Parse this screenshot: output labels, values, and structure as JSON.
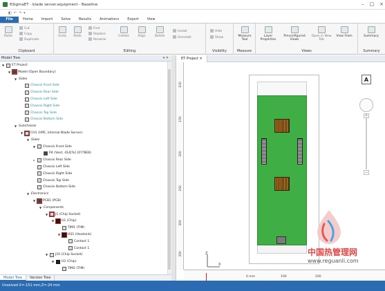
{
  "window": {
    "title": "6SigmaET - blade server.equipment - Baseline",
    "controls": [
      "–",
      "□",
      "×"
    ]
  },
  "quick_access": [
    "◧",
    "↶",
    "↷",
    "▾"
  ],
  "menu": [
    "File",
    "Home",
    "Import",
    "Solve",
    "Results",
    "Animations",
    "Export",
    "View"
  ],
  "ribbon": {
    "clipboard": {
      "label": "Clipboard",
      "paste": "Paste",
      "cut": "Cut",
      "copy": "Copy",
      "duplicate": "Duplicate"
    },
    "editing": {
      "label": "Editing",
      "undo": "Undo",
      "redo": "Redo",
      "find": "Find",
      "replace": "Replace",
      "rename": "Rename",
      "collate": "Collate",
      "align": "Align",
      "delete": "Delete",
      "install": "Install",
      "uninstall": "Uninstall"
    },
    "visibility": {
      "label": "Visibility",
      "hide": "Hide",
      "show": "Show"
    },
    "measure": {
      "label": "Measure",
      "tool": "Measure Tool"
    },
    "views": {
      "label": "Views",
      "layer_properties": "Layer Properties",
      "preconfigured": "Preconfigured Views",
      "open_new_tab": "Open in New Tab",
      "view_from": "View From"
    },
    "summary": {
      "label": "Summary",
      "button": "Summary"
    }
  },
  "model_tree": {
    "header": "Model Tree",
    "header_controls": "▾ ✕",
    "rows": [
      {
        "depth": 0,
        "arrow": "▼",
        "icon": "project",
        "text": "ET Project",
        "style": ""
      },
      {
        "depth": 1,
        "arrow": "▼",
        "icon": "model",
        "text": "Model (Open Boundary)",
        "style": "",
        "sel": true
      },
      {
        "depth": 2,
        "arrow": "▼",
        "icon": "none",
        "text": "Sides",
        "style": "italic"
      },
      {
        "depth": 3,
        "arrow": "",
        "icon": "side",
        "text": "Chassis Front Side",
        "style": "teal"
      },
      {
        "depth": 3,
        "arrow": "",
        "icon": "side",
        "text": "Chassis Rear Side",
        "style": "teal"
      },
      {
        "depth": 3,
        "arrow": "",
        "icon": "side",
        "text": "Chassis Left Side",
        "style": "teal"
      },
      {
        "depth": 3,
        "arrow": "",
        "icon": "side",
        "text": "Chassis Right Side",
        "style": "teal"
      },
      {
        "depth": 3,
        "arrow": "",
        "icon": "side",
        "text": "Chassis Top Side",
        "style": "teal"
      },
      {
        "depth": 3,
        "arrow": "",
        "icon": "side",
        "text": "Chassis Bottom Side",
        "style": "teal"
      },
      {
        "depth": 2,
        "arrow": "▼",
        "icon": "none",
        "text": "Subchassis",
        "style": "italic"
      },
      {
        "depth": 3,
        "arrow": "▼",
        "icon": "chassis",
        "text": "CH1 (HPE, Internal Blade Server)",
        "style": "",
        "sel": true
      },
      {
        "depth": 4,
        "arrow": "▼",
        "icon": "none",
        "text": "Sides",
        "style": "italic"
      },
      {
        "depth": 5,
        "arrow": "▼",
        "icon": "face",
        "text": "Chassis Front Side",
        "style": ""
      },
      {
        "depth": 6,
        "arrow": "",
        "icon": "dark",
        "text": "P4 (Vent, 414[%] (0?78E8)",
        "style": ""
      },
      {
        "depth": 5,
        "arrow": "▸",
        "icon": "face",
        "text": "Chassis Rear Side",
        "style": ""
      },
      {
        "depth": 5,
        "arrow": "",
        "icon": "face",
        "text": "Chassis Left Side",
        "style": ""
      },
      {
        "depth": 5,
        "arrow": "",
        "icon": "face",
        "text": "Chassis Right Side",
        "style": ""
      },
      {
        "depth": 5,
        "arrow": "",
        "icon": "face",
        "text": "Chassis Top Side",
        "style": ""
      },
      {
        "depth": 5,
        "arrow": "",
        "icon": "face",
        "text": "Chassis Bottom Side",
        "style": ""
      },
      {
        "depth": 4,
        "arrow": "▼",
        "icon": "none",
        "text": "Electronics",
        "style": "italic"
      },
      {
        "depth": 5,
        "arrow": "▼",
        "icon": "pcb",
        "text": "PCB1 (PCB)",
        "style": "",
        "sel": true
      },
      {
        "depth": 6,
        "arrow": "▼",
        "icon": "none",
        "text": "Components",
        "style": "italic"
      },
      {
        "depth": 7,
        "arrow": "▼",
        "icon": "socket",
        "text": "J1 (Chip Socket)",
        "style": "",
        "sel": true
      },
      {
        "depth": 8,
        "arrow": "▼",
        "icon": "chip",
        "text": "U1 (Chip)",
        "style": "",
        "sel": true
      },
      {
        "depth": 9,
        "arrow": "",
        "icon": "tim",
        "text": "TIM1 (TIM)",
        "style": ""
      },
      {
        "depth": 9,
        "arrow": "▼",
        "icon": "heatsink",
        "text": "HS1 (Heatsink)",
        "style": "",
        "sel": true
      },
      {
        "depth": 10,
        "arrow": "",
        "icon": "contact",
        "text": "Contact 1",
        "style": ""
      },
      {
        "depth": 10,
        "arrow": "",
        "icon": "contact",
        "text": "Contact 1",
        "style": ""
      },
      {
        "depth": 7,
        "arrow": "▼",
        "icon": "socket",
        "text": "J10 (Chip Socket)",
        "style": ""
      },
      {
        "depth": 8,
        "arrow": "▼",
        "icon": "chip",
        "text": "U2 (Chip)",
        "style": ""
      },
      {
        "depth": 9,
        "arrow": "",
        "icon": "tim",
        "text": "TIM2 (TIM)",
        "style": ""
      }
    ]
  },
  "bottom_tabs": [
    "Model Tree",
    "Version Tree"
  ],
  "document_tab": "ET Project ✕",
  "canvas": {
    "ruler_left_labels": [
      "100",
      "150",
      "200",
      "250",
      "300",
      "350"
    ],
    "ruler_bottom_labels": [
      "0 mm",
      "100",
      "200"
    ],
    "view_label": "A",
    "axis_z": "Z",
    "axis_x": "X"
  },
  "status": "Unsolved  X=-151 mm,Z=-24 mm",
  "watermark": {
    "cn": "中国热管理网",
    "url": "www.reguanli.com"
  },
  "colors": {
    "accent": "#2b6bb2",
    "board": "#3fae45",
    "select": "#d61e1e"
  }
}
